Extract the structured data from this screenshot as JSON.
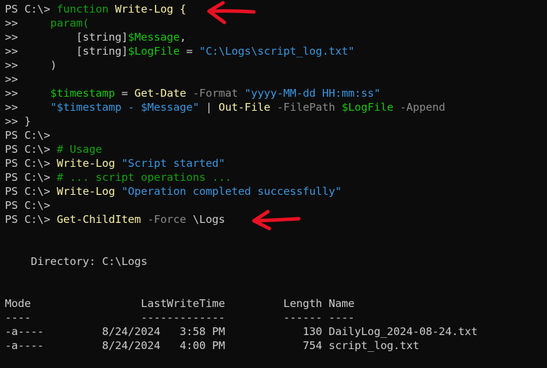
{
  "colors": {
    "background": "#0c0c0c",
    "default": "#cccccc",
    "keyword": "#13a10e",
    "command": "#f9f1a5",
    "variable": "#16c60c",
    "string": "#3a96dd",
    "parameter": "#8a8a8a",
    "comment": "#13a10e",
    "annotation_arrow": "#e81123"
  },
  "lines": [
    {
      "segs": [
        [
          "PS C:\\> ",
          "default"
        ],
        [
          "function ",
          "keyword"
        ],
        [
          "Write-Log {",
          "command"
        ]
      ]
    },
    {
      "segs": [
        [
          ">>     ",
          "default"
        ],
        [
          "param(",
          "keyword"
        ]
      ]
    },
    {
      "segs": [
        [
          ">>         [string]",
          "default"
        ],
        [
          "$Message",
          "variable"
        ],
        [
          ",",
          "default"
        ]
      ]
    },
    {
      "segs": [
        [
          ">>         [string]",
          "default"
        ],
        [
          "$LogFile",
          "variable"
        ],
        [
          " = ",
          "default"
        ],
        [
          "\"C:\\Logs\\script_log.txt\"",
          "string"
        ]
      ]
    },
    {
      "segs": [
        [
          ">>     )",
          "default"
        ]
      ]
    },
    {
      "segs": [
        [
          ">>",
          "default"
        ]
      ]
    },
    {
      "segs": [
        [
          ">>     ",
          "default"
        ],
        [
          "$timestamp",
          "variable"
        ],
        [
          " = ",
          "default"
        ],
        [
          "Get-Date",
          "command"
        ],
        [
          " -Format ",
          "parameter"
        ],
        [
          "\"yyyy-MM-dd HH:mm:ss\"",
          "string"
        ]
      ]
    },
    {
      "segs": [
        [
          ">>     ",
          "default"
        ],
        [
          "\"$timestamp - $Message\"",
          "string"
        ],
        [
          " | ",
          "default"
        ],
        [
          "Out-File",
          "command"
        ],
        [
          " -FilePath ",
          "parameter"
        ],
        [
          "$LogFile",
          "variable"
        ],
        [
          " -Append",
          "parameter"
        ]
      ]
    },
    {
      "segs": [
        [
          ">> }",
          "default"
        ]
      ]
    },
    {
      "segs": [
        [
          "PS C:\\>",
          "default"
        ]
      ]
    },
    {
      "segs": [
        [
          "PS C:\\> ",
          "default"
        ],
        [
          "# Usage",
          "comment"
        ]
      ]
    },
    {
      "segs": [
        [
          "PS C:\\> ",
          "default"
        ],
        [
          "Write-Log",
          "command"
        ],
        [
          " ",
          "default"
        ],
        [
          "\"Script started\"",
          "string"
        ]
      ]
    },
    {
      "segs": [
        [
          "PS C:\\> ",
          "default"
        ],
        [
          "# ... script operations ...",
          "comment"
        ]
      ]
    },
    {
      "segs": [
        [
          "PS C:\\> ",
          "default"
        ],
        [
          "Write-Log",
          "command"
        ],
        [
          " ",
          "default"
        ],
        [
          "\"Operation completed successfully\"",
          "string"
        ]
      ]
    },
    {
      "segs": [
        [
          "PS C:\\>",
          "default"
        ]
      ]
    },
    {
      "segs": [
        [
          "PS C:\\> ",
          "default"
        ],
        [
          "Get-ChildItem",
          "command"
        ],
        [
          " -Force ",
          "parameter"
        ],
        [
          "\\Logs",
          "default"
        ]
      ]
    },
    {
      "segs": []
    },
    {
      "segs": []
    },
    {
      "segs": [
        [
          "    Directory: C:\\Logs",
          "default"
        ]
      ]
    },
    {
      "segs": []
    },
    {
      "segs": []
    },
    {
      "segs": [
        [
          "Mode                 LastWriteTime         Length Name",
          "default"
        ]
      ]
    },
    {
      "segs": [
        [
          "----                 -------------         ------ ----",
          "default"
        ]
      ]
    },
    {
      "segs": [
        [
          "-a----         8/24/2024   3:58 PM            130 DailyLog_2024-08-24.txt",
          "default"
        ]
      ]
    },
    {
      "segs": [
        [
          "-a----         8/24/2024   4:00 PM            754 script_log.txt",
          "default"
        ]
      ]
    }
  ]
}
